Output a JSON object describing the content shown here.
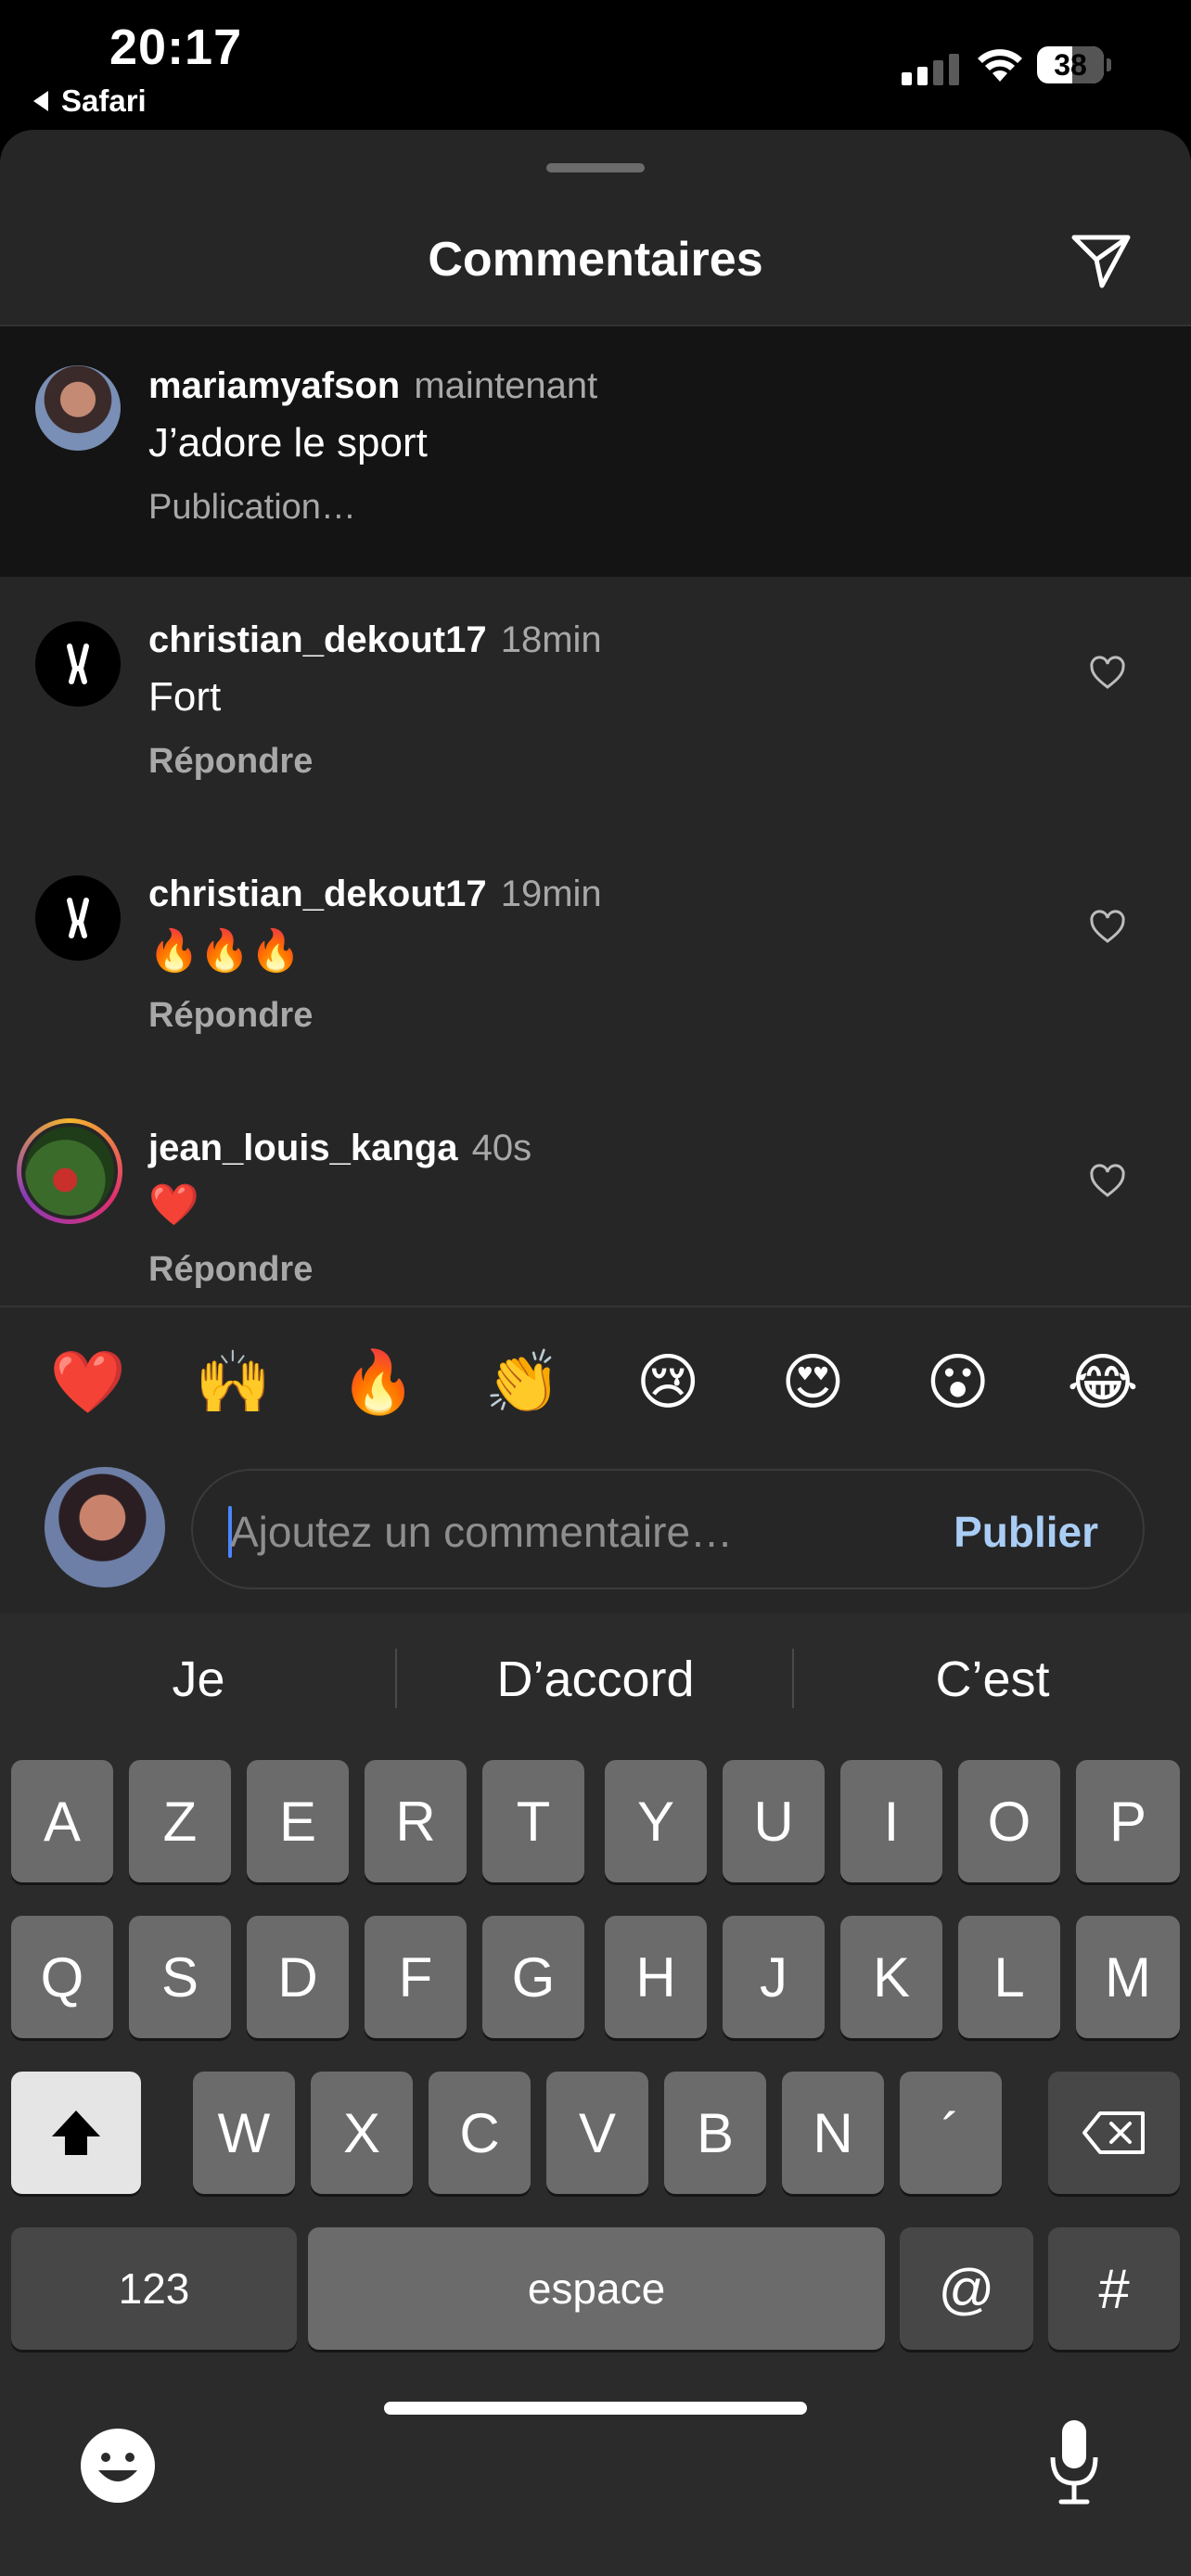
{
  "status_bar": {
    "time": "20:17",
    "back_app": "Safari",
    "battery": "38"
  },
  "sheet": {
    "title": "Commentaires"
  },
  "comments": [
    {
      "user": "mariamyafson",
      "time": "maintenant",
      "text": "J’adore le sport",
      "sub": "Publication…",
      "own": true
    },
    {
      "user": "christian_dekout17",
      "time": "18min",
      "text": "Fort",
      "sub": "Répondre"
    },
    {
      "user": "christian_dekout17",
      "time": "19min",
      "text": "🔥🔥🔥",
      "sub": "Répondre"
    },
    {
      "user": "jean_louis_kanga",
      "time": "40s",
      "text": "❤️",
      "sub": "Répondre"
    }
  ],
  "quick_emojis": [
    "❤️",
    "🙌",
    "🔥",
    "👏",
    "😢",
    "😍",
    "😮",
    "😂"
  ],
  "composer": {
    "placeholder": "Ajoutez un commentaire…",
    "publish_label": "Publier"
  },
  "keyboard": {
    "suggestions": [
      "Je",
      "D’accord",
      "C’est"
    ],
    "row1": [
      "A",
      "Z",
      "E",
      "R",
      "T",
      "Y",
      "U",
      "I",
      "O",
      "P"
    ],
    "row2": [
      "Q",
      "S",
      "D",
      "F",
      "G",
      "H",
      "J",
      "K",
      "L",
      "M"
    ],
    "row3": [
      "W",
      "X",
      "C",
      "V",
      "B",
      "N",
      "´"
    ],
    "numbers_label": "123",
    "space_label": "espace",
    "at_label": "@",
    "hash_label": "#"
  }
}
